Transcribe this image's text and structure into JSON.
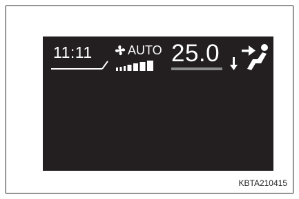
{
  "display": {
    "clock": "11:11",
    "mode": "AUTO",
    "temperature": "25.0",
    "fan_speed": {
      "level": 4,
      "max": 7
    },
    "icons": [
      "fan-icon",
      "airflow-face-down-icon"
    ],
    "colors": {
      "panel": "#231f20",
      "text": "#ffffff",
      "temp_underline": "#8c8c8c"
    }
  },
  "caption": "KBTA210415"
}
